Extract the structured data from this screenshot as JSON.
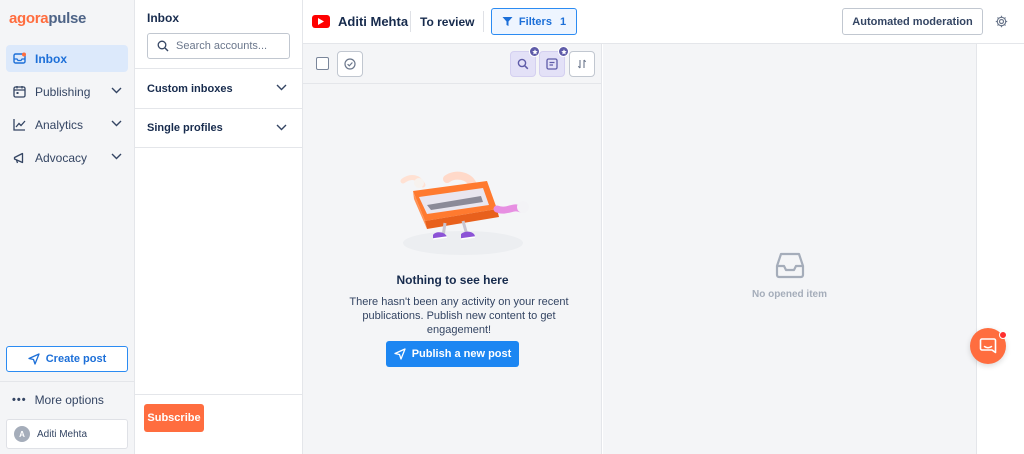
{
  "brand": {
    "part1": "agora",
    "part2": "pulse",
    "color_primary": "#ff6d3f",
    "color_secondary": "#4e6487"
  },
  "nav": {
    "items": [
      {
        "label": "Inbox",
        "icon": "inbox-icon",
        "active": true
      },
      {
        "label": "Publishing",
        "icon": "calendar-icon",
        "expandable": true
      },
      {
        "label": "Analytics",
        "icon": "chart-icon",
        "expandable": true
      },
      {
        "label": "Advocacy",
        "icon": "megaphone-icon",
        "expandable": true
      }
    ],
    "create_post": "Create post",
    "more_options": "More options",
    "user": {
      "initial": "A",
      "name": "Aditi Mehta"
    }
  },
  "inbox_panel": {
    "title": "Inbox",
    "search_placeholder": "Search accounts...",
    "sections": [
      "Custom inboxes",
      "Single profiles"
    ],
    "subscribe": "Subscribe"
  },
  "topbar": {
    "profile_name": "Aditi Mehta",
    "profile_network_icon": "youtube-icon",
    "view": "To review",
    "filters_label": "Filters",
    "filters_count": "1",
    "automated_moderation": "Automated moderation"
  },
  "feed": {
    "empty_title": "Nothing to see here",
    "empty_text": "There hasn't been any activity on your recent publications. Publish new content to get engagement!",
    "publish_button": "Publish a new post"
  },
  "detail": {
    "empty_text": "No opened item"
  },
  "colors": {
    "accent_blue": "#1c86f2",
    "accent_orange": "#ff6d3f",
    "active_bg": "#dce9fb"
  }
}
